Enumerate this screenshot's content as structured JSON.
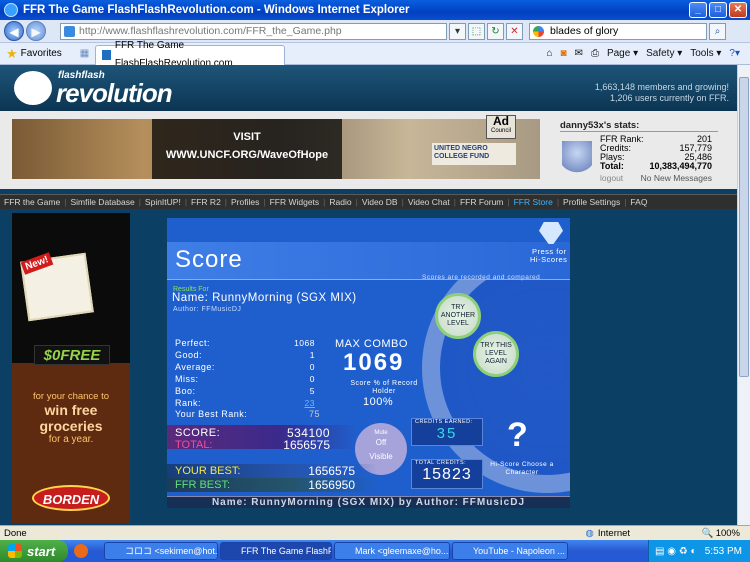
{
  "window": {
    "title": "FFR The Game FlashFlashRevolution.com - Windows Internet Explorer",
    "min": "_",
    "max": "□",
    "close": "✕"
  },
  "address": {
    "url": "http://www.flashflashrevolution.com/FFR_the_Game.php",
    "search": "blades of glory"
  },
  "favorites": {
    "label": "Favorites",
    "tab": "FFR The Game FlashFlashRevolution.com"
  },
  "commandbar": {
    "page": "Page ▾",
    "safety": "Safety ▾",
    "tools": "Tools ▾"
  },
  "site": {
    "logo_small": "flashflash",
    "logo_big": "revolution",
    "members": "1,663,148 members and growing!",
    "online": "1,206 users currently on FFR."
  },
  "banner": {
    "visit": "VISIT",
    "url": "WWW.UNCF.ORG/WaveOfHope",
    "ad": "Ad",
    "ad2": "Council",
    "org": "UNITED NEGRO COLLEGE FUND"
  },
  "stats": {
    "title": "danny53x's stats:",
    "rows": [
      {
        "label": "FFR Rank:",
        "value": "201"
      },
      {
        "label": "Credits:",
        "value": "157,779"
      },
      {
        "label": "Plays:",
        "value": "25,486"
      },
      {
        "label": "Total:",
        "value": "10,383,494,770"
      }
    ],
    "logout": "logout",
    "messages": "No New Messages"
  },
  "nav": [
    "FFR the Game",
    "Simfile Database",
    "SpinItUP!",
    "FFR R2",
    "Profiles",
    "FFR Widgets",
    "Radio",
    "Video DB",
    "Video Chat",
    "FFR Forum",
    "FFR Store",
    "Profile Settings",
    "FAQ"
  ],
  "leftad": {
    "new": "New!",
    "free": "$0FREE",
    "l1": "for your chance to",
    "l2": "win free",
    "l3": "groceries",
    "l4": "for a year.",
    "brand": "BORDEN"
  },
  "game": {
    "title": "Score",
    "press": "Press for",
    "hiscores": "Hi-Scores",
    "recorded": "Scores are recorded and compared",
    "results_for": "Results For",
    "song_name": "Name: RunnyMorning (SGX MIX)",
    "author": "Author: FFMusicDJ",
    "try_another": "TRY ANOTHER LEVEL",
    "try_again": "TRY THIS LEVEL AGAIN",
    "stats": [
      {
        "label": "Perfect:",
        "value": "1068"
      },
      {
        "label": "Good:",
        "value": "1"
      },
      {
        "label": "Average:",
        "value": "0"
      },
      {
        "label": "Miss:",
        "value": "0"
      },
      {
        "label": "Boo:",
        "value": "5"
      },
      {
        "label": "Rank:",
        "value": "23"
      }
    ],
    "your_best_rank_label": "Your Best Rank:",
    "your_best_rank": "75",
    "max_combo_label": "MAX COMBO",
    "max_combo": "1069",
    "score_pct_label": "Score % of Record Holder",
    "score_pct": "100%",
    "score_label": "SCORE:",
    "score": "534100",
    "total_label": "TOTAL:",
    "total": "1656575",
    "your_best_label": "YOUR BEST:",
    "your_best": "1656575",
    "ffr_best_label": "FFR BEST:",
    "ffr_best": "1656950",
    "mute_label": "Mute",
    "mute_value": "Off",
    "visible": "Visible",
    "credits_earned_label": "CREDITS EARNED:",
    "credits_earned": "35",
    "total_credits_label": "TOTAL CREDITS:",
    "total_credits": "15823",
    "choose": "Hi-Score Choose a Character",
    "question": "?",
    "footer": "Name: RunnyMorning (SGX MIX) by Author: FFMusicDJ"
  },
  "status": {
    "left": "Done",
    "zone": "Internet",
    "zoom": "100%"
  },
  "taskbar": {
    "start": "start",
    "tasks": [
      "コロコ <sekimen@hot...",
      "FFR The Game FlashF...",
      "Mark <gleemaxe@ho...",
      "YouTube - Napoleon ..."
    ],
    "time": "5:53 PM"
  },
  "colors": {
    "accent": "#1f5fcd",
    "nav_active": "#37b7ff",
    "green": "#88e25b"
  }
}
